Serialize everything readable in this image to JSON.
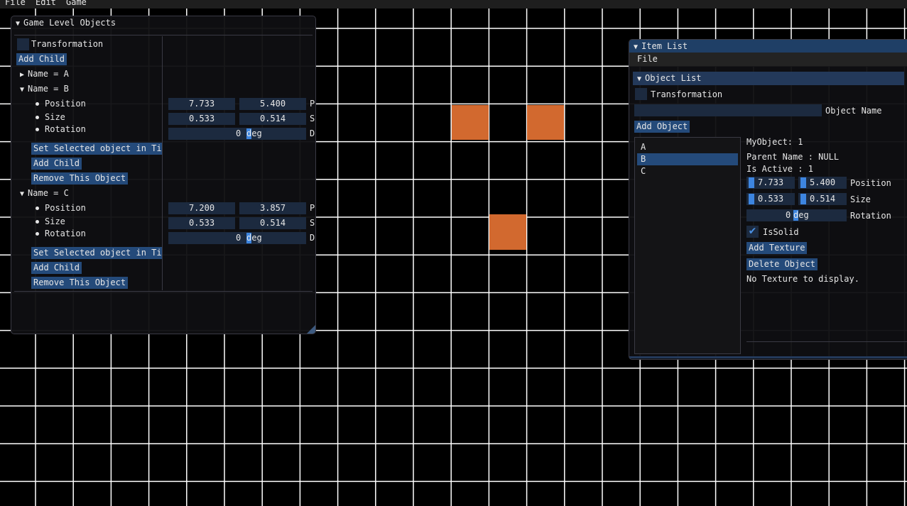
{
  "menu": {
    "file": "File",
    "edit": "Edit",
    "game": "Game"
  },
  "tiles_color": "#d2692f",
  "level_window": {
    "title": "Game Level Objects",
    "transformation_label": "Transformation",
    "add_child": "Add Child",
    "node_a": "Name = A",
    "node_b": {
      "label": "Name = B",
      "position_label": "Position",
      "size_label": "Size",
      "rotation_label": "Rotation",
      "pos_x": "7.733",
      "pos_y": "5.400",
      "pos_suffix": "P",
      "size_x": "0.533",
      "size_y": "0.514",
      "size_suffix": "S",
      "rot_value": "0",
      "rot_unit": "deg",
      "rot_suffix": "D",
      "set_selected": "Set Selected object in Til",
      "add_child": "Add Child",
      "remove": "Remove This Object"
    },
    "node_c": {
      "label": "Name = C",
      "position_label": "Position",
      "size_label": "Size",
      "rotation_label": "Rotation",
      "pos_x": "7.200",
      "pos_y": "3.857",
      "pos_suffix": "P",
      "size_x": "0.533",
      "size_y": "0.514",
      "size_suffix": "S",
      "rot_value": "0",
      "rot_unit": "deg",
      "rot_suffix": "D",
      "set_selected": "Set Selected object in Til",
      "add_child": "Add Child",
      "remove": "Remove This Object"
    }
  },
  "item_window": {
    "title": "Item List",
    "menu_file": "File",
    "header": "Object List",
    "transformation_label": "Transformation",
    "object_name_value": "",
    "object_name_label": "Object Name",
    "add_object": "Add Object",
    "list": [
      "A",
      "B",
      "C"
    ],
    "selected_index": 1,
    "details": {
      "my_object": "MyObject: 1",
      "parent_name": "Parent Name : NULL",
      "is_active": "Is Active : 1",
      "pos_x": "7.733",
      "pos_y": "5.400",
      "position_label": "Position",
      "size_x": "0.533",
      "size_y": "0.514",
      "size_label": "Size",
      "rot_value": "0",
      "rot_unit": "deg",
      "rotation_label": "Rotation",
      "is_solid_label": "IsSolid",
      "is_solid_checked": true,
      "add_texture": "Add Texture",
      "delete_object": "Delete Object",
      "no_texture": "No Texture to display."
    }
  }
}
